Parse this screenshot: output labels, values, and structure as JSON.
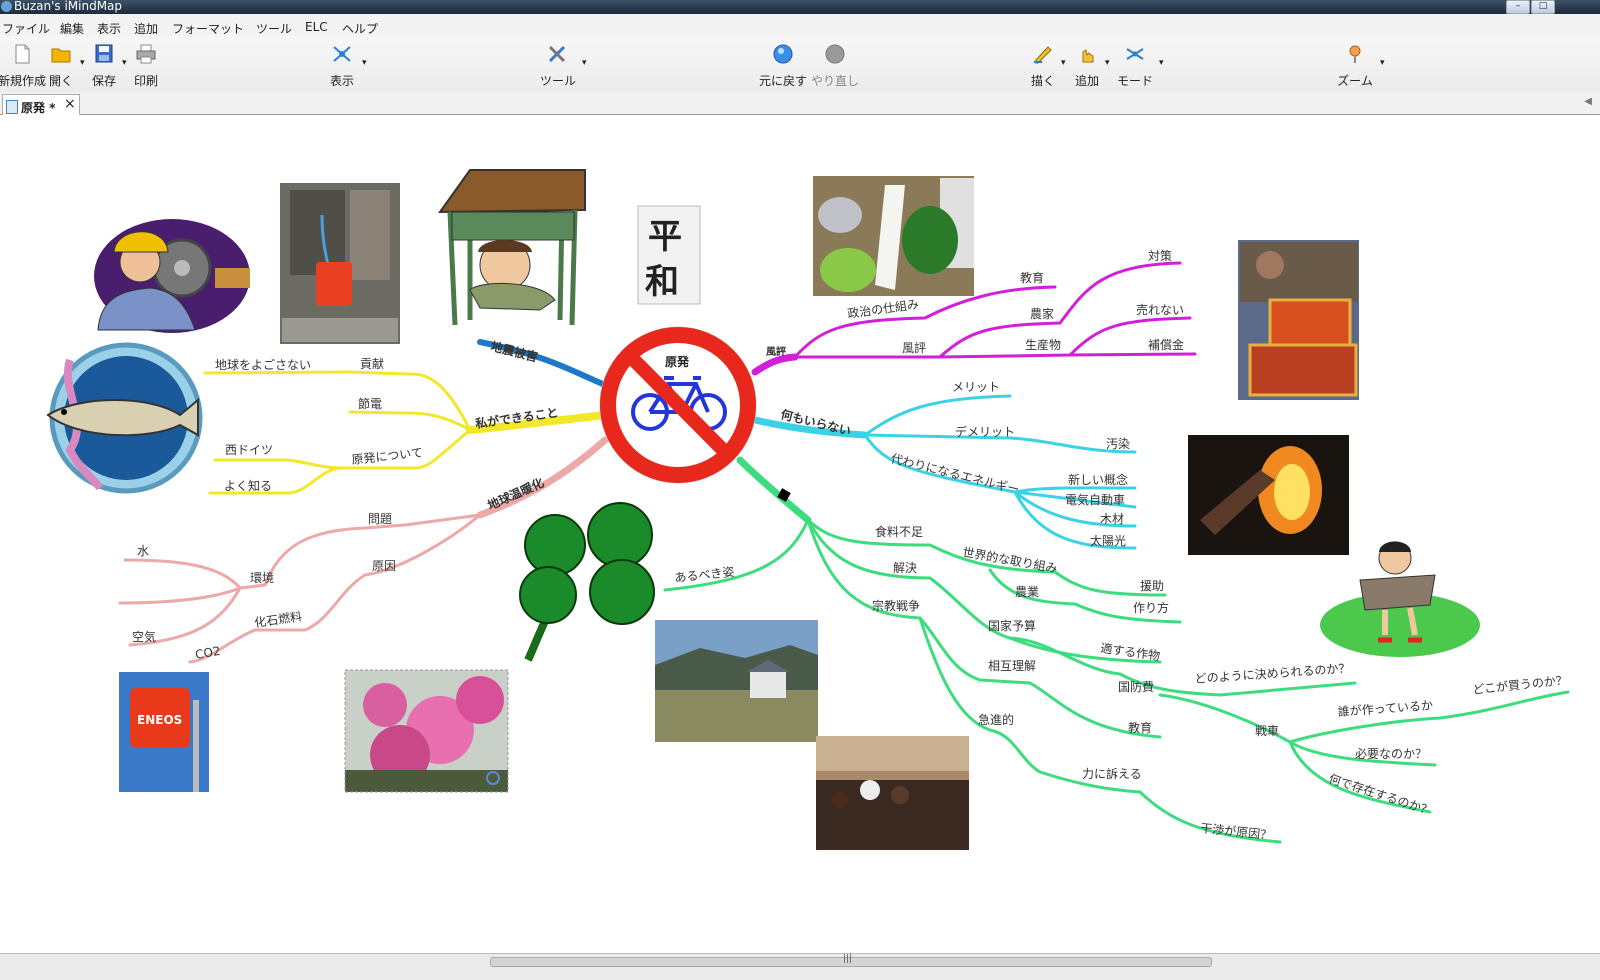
{
  "window": {
    "title": "Buzan's iMindMap"
  },
  "menu": [
    "ファイル",
    "編集",
    "表示",
    "追加",
    "フォーマット",
    "ツール",
    "ELC",
    "ヘルプ"
  ],
  "toolbar": {
    "new": "新規作成",
    "open": "開く",
    "save": "保存",
    "print": "印刷",
    "view": "表示",
    "tools": "ツール",
    "undo": "元に戻す",
    "redo": "やり直し",
    "draw": "描く",
    "add": "追加",
    "mode": "モード",
    "zoom": "ズーム"
  },
  "tab": {
    "label": "原発 *"
  },
  "mindmap": {
    "central": "原発",
    "branches": {
      "quake": {
        "label": "地震被害"
      },
      "cando": {
        "label": "私ができること",
        "kouken": "貢献",
        "chikyu": "地球をよごさない",
        "setsuden": "節電",
        "about": "原発について",
        "nishidoitsu": "西ドイツ",
        "yokushiru": "よく知る"
      },
      "warming": {
        "label": "地球温暖化",
        "mondai": "問題",
        "kankyo": "環境",
        "mizu": "水",
        "kuuki": "空気",
        "genin": "原因",
        "kaseki": "化石燃料",
        "co2": "CO2"
      },
      "damage": {
        "label": "風評",
        "seiji": "政治の仕組み",
        "kyoiku": "教育",
        "fuhyo": "風評",
        "nouka": "農家",
        "taisaku": "対策",
        "seisanbutsu": "生産物",
        "urenai": "売れない",
        "hoshokin": "補償金"
      },
      "need": {
        "label": "何もいらない",
        "merit": "メリット",
        "demerit": "デメリット",
        "osen": "汚染",
        "kawari": "代わりになるエネルギー",
        "gainen": "新しい概念",
        "ev": "電気自動車",
        "mokuzai": "木材",
        "taiyo": "太陽光"
      },
      "future": {
        "arubeki": "あるべき姿",
        "shokuryo": "食料不足",
        "sekai": "世界的な取り組み",
        "enjo": "援助",
        "nougyo": "農業",
        "tsukurikata": "作り方",
        "tekisuru": "適する作物",
        "kaiketsu": "解決",
        "yosan": "国家予算",
        "kokuboh": "国防費",
        "dono": "どのように決められるのか？",
        "sensha": "戦車",
        "dare": "誰が作っているか",
        "doko": "どこが買うのか？",
        "hitsuyo": "必要なのか？",
        "naze": "何で存在するのか？",
        "shukyo": "宗教戦争",
        "sogo": "相互理解",
        "kyoiku2": "教育",
        "kyushin": "急進的",
        "chikara": "力に訴える",
        "kansho": "干渉が原因？"
      }
    },
    "stamp": [
      "平",
      "和"
    ],
    "sign": "ENEOS"
  },
  "colors": {
    "magenta": "#d21fd8",
    "cyan": "#3cd2e6",
    "green": "#3ddc7e",
    "pink": "#eda8a8",
    "yellow": "#f2e82a",
    "blue": "#1e78c8",
    "red": "#e8281c"
  }
}
